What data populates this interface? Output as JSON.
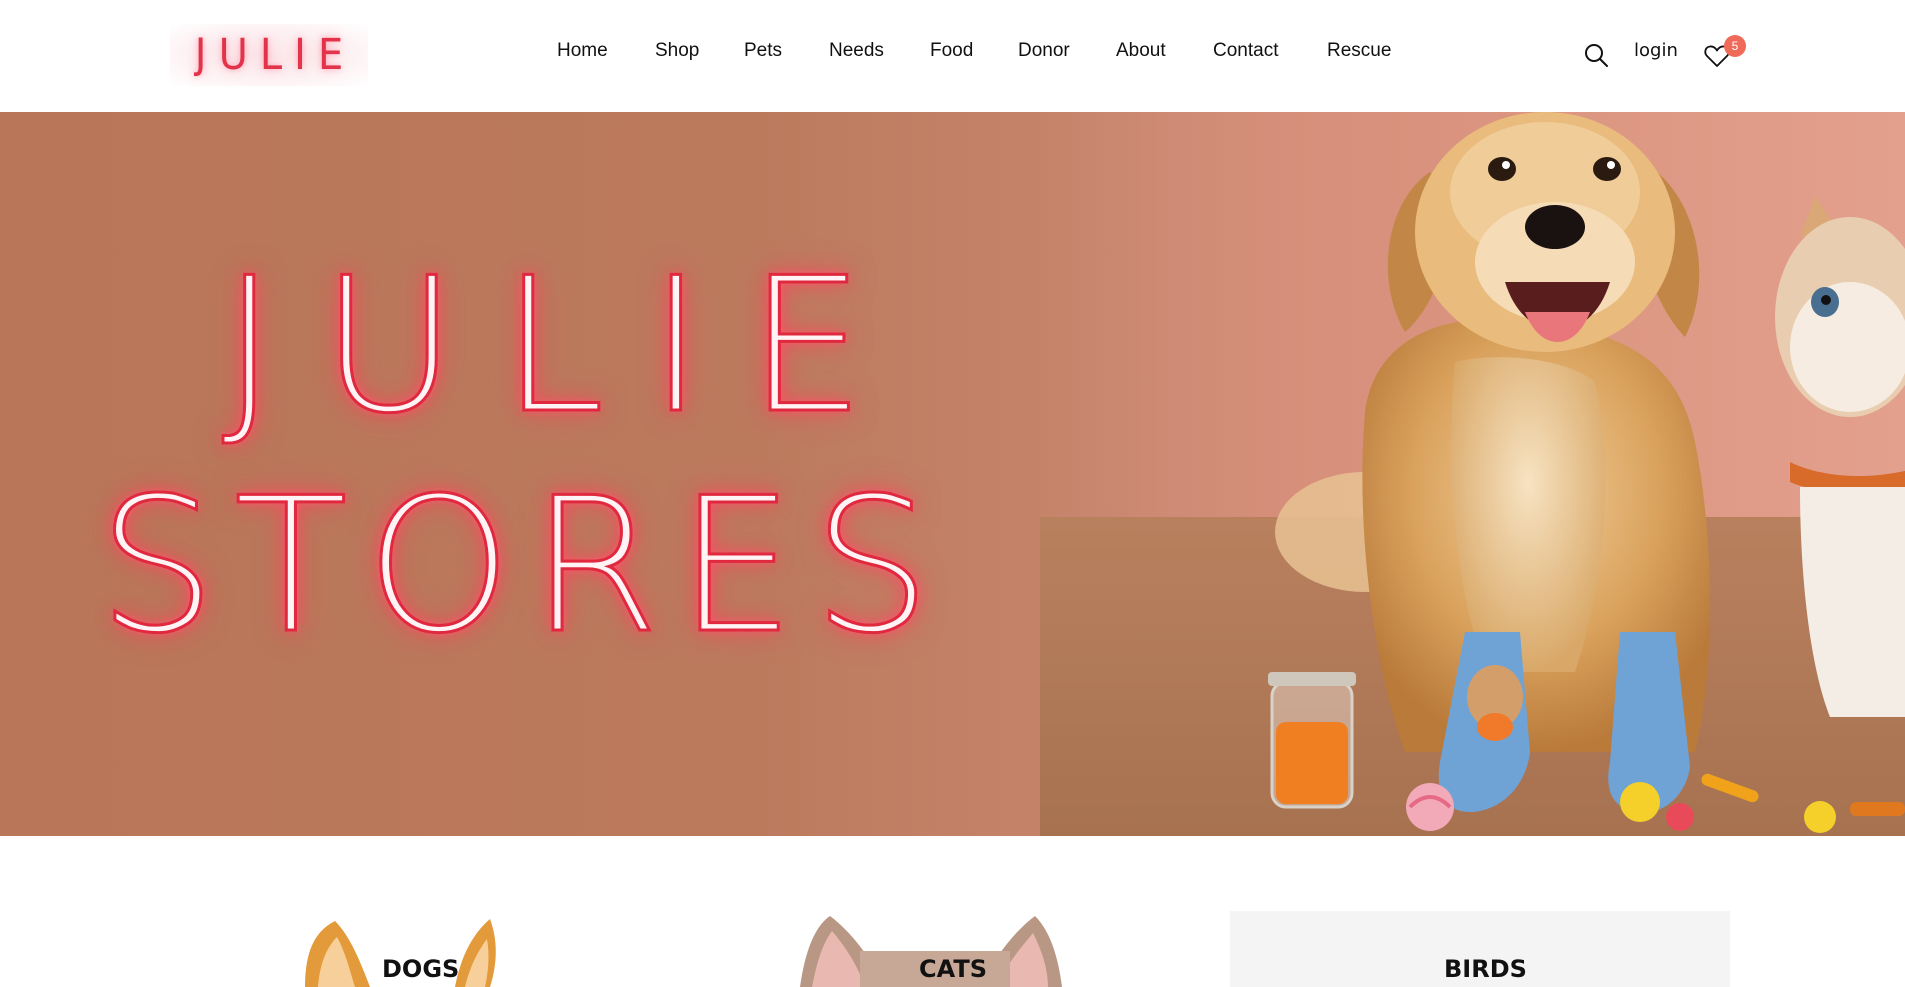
{
  "header": {
    "logo_text": "JULIE",
    "nav": [
      {
        "label": "Home"
      },
      {
        "label": "Shop"
      },
      {
        "label": "Pets"
      },
      {
        "label": "Needs"
      },
      {
        "label": "Food"
      },
      {
        "label": "Donor"
      },
      {
        "label": "About"
      },
      {
        "label": "Contact"
      },
      {
        "label": "Rescue"
      }
    ],
    "search_icon": "search-icon",
    "login_label": "login",
    "wishlist_icon": "heart-icon",
    "wishlist_count": "5"
  },
  "hero": {
    "title_line1": "JULIE",
    "title_line2": "STORES",
    "neon_color": "#e0283e",
    "background_color": "#bc7a5d"
  },
  "categories": {
    "items": [
      {
        "label": "DOGS"
      },
      {
        "label": "CATS"
      },
      {
        "label": "BIRDS"
      }
    ]
  },
  "colors": {
    "accent": "#f06a5a",
    "badge": "#f06a5a"
  }
}
